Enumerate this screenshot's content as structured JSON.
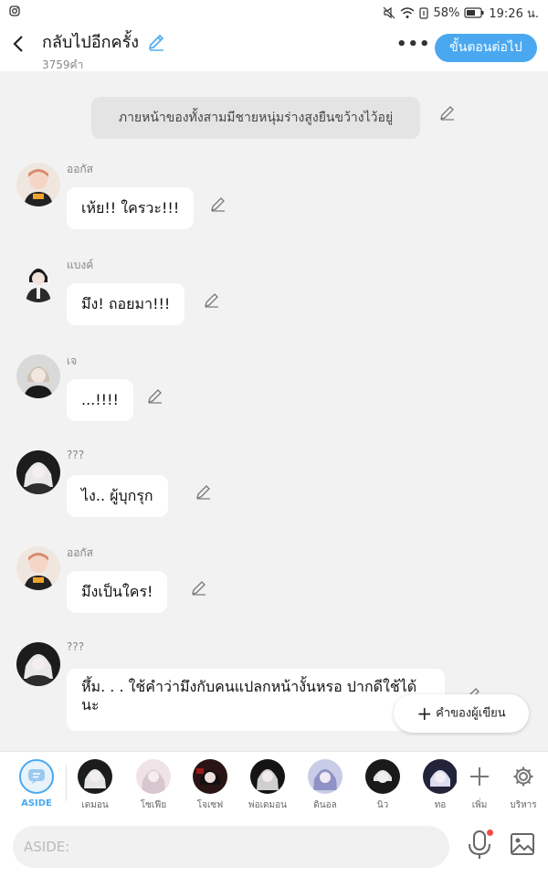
{
  "statusbar": {
    "battery_percent": "58%",
    "time": "19:26 น.",
    "icons": [
      "instagram-icon",
      "mute-icon",
      "wifi-icon",
      "data-icon",
      "battery-icon"
    ]
  },
  "header": {
    "title": "กลับไปอีกครั้ง",
    "word_count": "3759คำ",
    "more_label": "•••",
    "next_label": "ขั้นตอนต่อไป",
    "accent_color": "#4aa8f0"
  },
  "chat": {
    "narration": "ภายหน้าของทั้งสามมีชายหนุ่มร่างสูงยืนขว้างไว้อยู่",
    "messages": [
      {
        "speaker": "ออกัส",
        "text": "เห้ย!! ใครวะ!!!"
      },
      {
        "speaker": "แบงค์",
        "text": "มึง! ถอยมา!!!"
      },
      {
        "speaker": "เจ",
        "text": "...!!!!"
      },
      {
        "speaker": "???",
        "text": "ไง.. ผู้บุกรุก"
      },
      {
        "speaker": "ออกัส",
        "text": "มึงเป็นใคร!"
      },
      {
        "speaker": "???",
        "text": "หึ้ม. . . ใช้คำว่ามึงกับคนแปลกหน้างั้นหรอ ปากดีใช้ได้นะ"
      }
    ]
  },
  "floating": {
    "writer_note_label": "คำของผู้เขียน"
  },
  "characters": [
    {
      "label": "ASIDE"
    },
    {
      "label": "เดมอน"
    },
    {
      "label": "โซเฟีย"
    },
    {
      "label": "โจเซฟ"
    },
    {
      "label": "พ่อเดมอน"
    },
    {
      "label": "ดินอล"
    },
    {
      "label": "นิว"
    },
    {
      "label": "ทอ"
    }
  ],
  "tools": {
    "add_label": "เพิ่ม",
    "manage_label": "บริหาร"
  },
  "input": {
    "placeholder": "ASIDE:"
  }
}
